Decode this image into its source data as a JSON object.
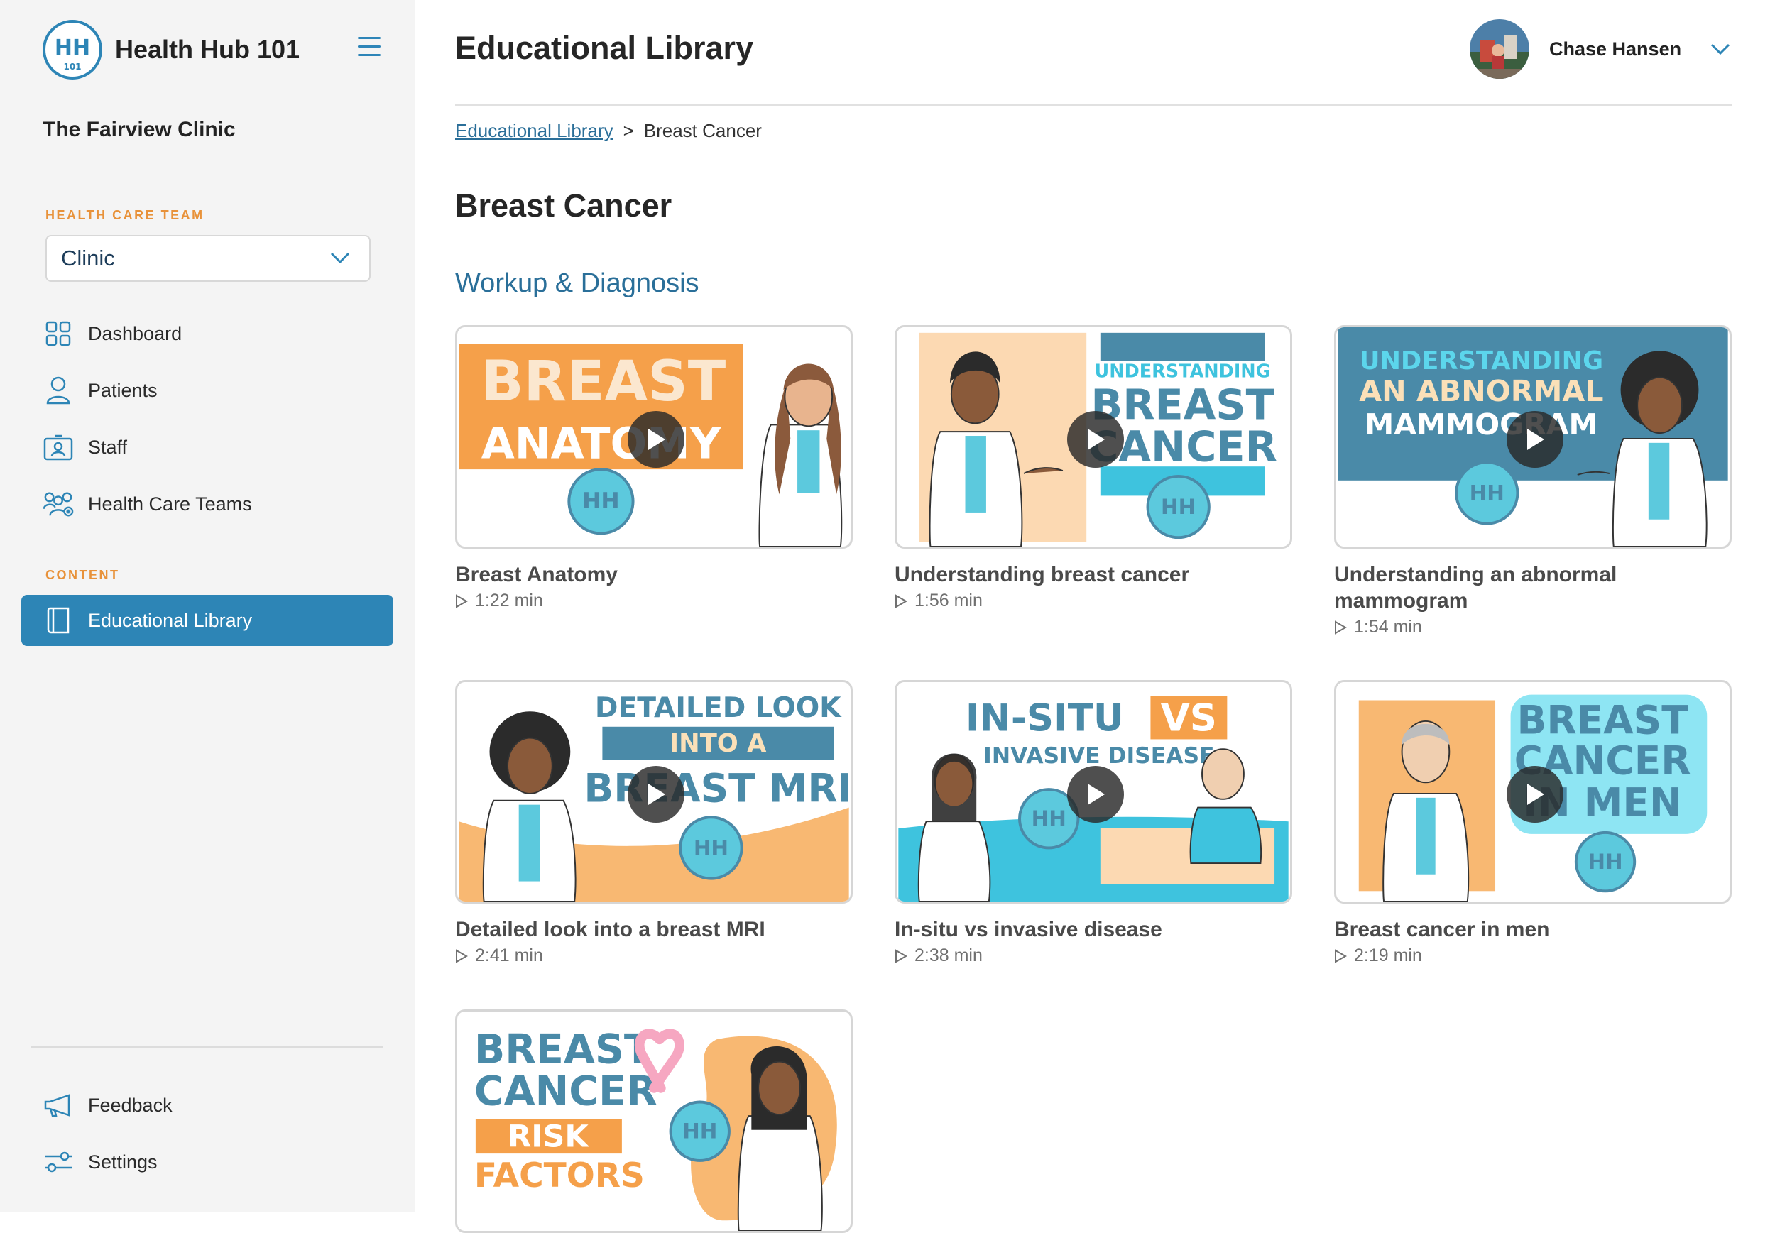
{
  "app": {
    "brand": "Health Hub 101",
    "logo_text": "HH",
    "logo_sub": "101",
    "clinic": "The Fairview Clinic"
  },
  "sidebar": {
    "team_label": "HEALTH CARE TEAM",
    "team_value": "Clinic",
    "nav": [
      {
        "label": "Dashboard",
        "icon": "grid-icon"
      },
      {
        "label": "Patients",
        "icon": "person-icon"
      },
      {
        "label": "Staff",
        "icon": "id-badge-icon"
      },
      {
        "label": "Health Care Teams",
        "icon": "team-icon"
      }
    ],
    "content_label": "CONTENT",
    "library": {
      "label": "Educational Library",
      "icon": "book-icon"
    },
    "bottom": [
      {
        "label": "Feedback",
        "icon": "megaphone-icon"
      },
      {
        "label": "Settings",
        "icon": "sliders-icon"
      }
    ]
  },
  "header": {
    "title": "Educational Library",
    "user_name": "Chase Hansen"
  },
  "breadcrumb": {
    "parent": "Educational Library",
    "separator": ">",
    "current": "Breast Cancer"
  },
  "page": {
    "title": "Breast Cancer",
    "section": "Workup & Diagnosis"
  },
  "videos": [
    {
      "title": "Breast Anatomy",
      "duration": "1:22 min",
      "thumb": [
        "BREAST",
        "ANATOMY"
      ]
    },
    {
      "title": "Understanding breast cancer",
      "duration": "1:56 min",
      "thumb": [
        "UNDERSTANDING",
        "BREAST",
        "CANCER"
      ]
    },
    {
      "title": "Understanding an abnormal mammogram",
      "duration": "1:54 min",
      "thumb": [
        "UNDERSTANDING",
        "AN ABNORMAL",
        "MAMMOGRAM"
      ]
    },
    {
      "title": "Detailed look into a breast MRI",
      "duration": "2:41 min",
      "thumb": [
        "DETAILED LOOK",
        "INTO A",
        "BREAST MRI"
      ]
    },
    {
      "title": "In-situ vs invasive disease",
      "duration": "2:38 min",
      "thumb": [
        "IN-SITU",
        "VS",
        "INVASIVE DISEASE"
      ]
    },
    {
      "title": "Breast cancer in men",
      "duration": "2:19 min",
      "thumb": [
        "BREAST",
        "CANCER",
        "IN MEN"
      ]
    },
    {
      "title": "",
      "duration": "",
      "thumb": [
        "BREAST",
        "CANCER",
        "RISK",
        "FACTORS"
      ]
    }
  ],
  "colors": {
    "accent": "#2d85b6",
    "orange": "#f5a04a",
    "teal": "#4a8aa8",
    "cyan": "#5cc9dd",
    "section_label": "#e8923a"
  }
}
